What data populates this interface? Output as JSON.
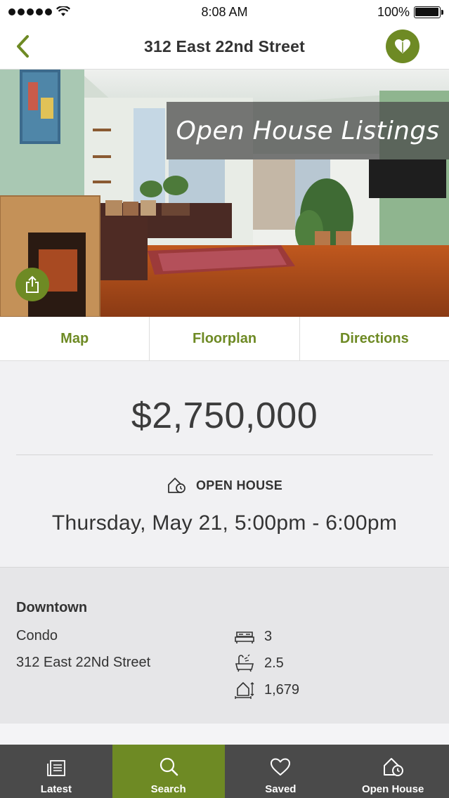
{
  "status_bar": {
    "time": "8:08 AM",
    "battery": "100%"
  },
  "nav": {
    "title": "312 East 22nd Street"
  },
  "hero": {
    "banner": "Open House Listings"
  },
  "tabs": [
    {
      "label": "Map"
    },
    {
      "label": "Floorplan"
    },
    {
      "label": "Directions"
    }
  ],
  "listing": {
    "price": "$2,750,000",
    "open_house_label": "OPEN HOUSE",
    "open_house_date": "Thursday, May 21, 5:00pm - 6:00pm",
    "neighborhood": "Downtown",
    "type": "Condo",
    "address": "312 East 22Nd Street",
    "beds": "3",
    "baths": "2.5",
    "sqft": "1,679"
  },
  "tab_bar": [
    {
      "label": "Latest",
      "icon": "news-icon"
    },
    {
      "label": "Search",
      "icon": "search-icon",
      "active": true
    },
    {
      "label": "Saved",
      "icon": "heart-icon"
    },
    {
      "label": "Open House",
      "icon": "open-house-icon"
    }
  ],
  "colors": {
    "accent": "#6e8a24",
    "tab_bar_bg": "#4a4a4a"
  }
}
